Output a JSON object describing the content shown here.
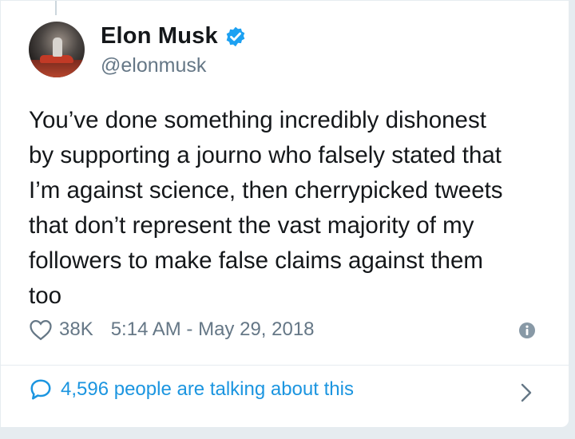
{
  "author": {
    "name": "Elon Musk",
    "handle": "@elonmusk",
    "verified": true
  },
  "tweet": {
    "text": "You’ve done something incredibly dishonest\nby supporting a journo who falsely stated that\nI’m against science, then cherrypicked tweets\nthat don’t represent the vast majority of my\nfollowers to make false claims against them\ntoo",
    "likes": "38K",
    "timestamp": "5:14 AM - May 29, 2018"
  },
  "conversation": {
    "label": "4,596 people are talking about this"
  },
  "icons": {
    "verified": "verified-badge-icon",
    "like": "heart-icon",
    "info": "info-icon",
    "reply": "speech-bubble-icon",
    "more": "chevron-right-icon"
  },
  "colors": {
    "accent": "#1da1f2",
    "link": "#1b95e0",
    "secondary_text": "#657786",
    "primary_text": "#14171a"
  }
}
